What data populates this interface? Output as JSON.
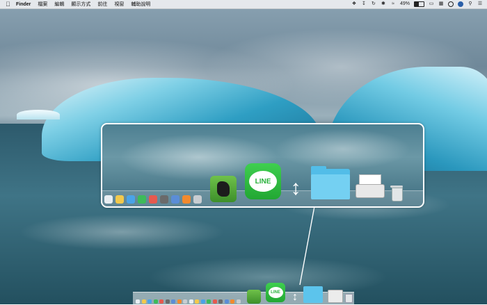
{
  "menubar": {
    "apple_icon": "apple-icon",
    "items": [
      "Finder",
      "檔案",
      "編輯",
      "顯示方式",
      "前往",
      "視窗",
      "輔助說明"
    ],
    "battery_percent": 49,
    "battery_label": "49%",
    "status_icons": [
      "dropbox-icon",
      "download-icon",
      "time-machine-icon",
      "bluetooth-icon",
      "wifi-icon",
      "airplay-icon",
      "keyboard-input-icon",
      "clock-icon",
      "user-icon",
      "spotlight-icon",
      "list-icon"
    ]
  },
  "zoom_callout": {
    "line_app_label": "LINE",
    "small_icon_colors": [
      "#e8eef2",
      "#f2c94c",
      "#4aa3e8",
      "#3dbb5a",
      "#e55a4f",
      "#6a6a6a",
      "#5b8dd6",
      "#f28a2e",
      "#c8cdd1"
    ]
  },
  "dock": {
    "line_app_label": "LINE",
    "apps": [
      "Finder",
      "Preview",
      "Calendar",
      "Maps",
      "Music",
      "App Store",
      "System Preferences",
      "Evernote",
      "LINE",
      "Script Editor",
      "Downloads",
      "Printer",
      "Trash"
    ]
  },
  "colors": {
    "line_green": "#28b13a",
    "evernote_green": "#5fb33c",
    "folder_blue": "#5cc4ec"
  }
}
